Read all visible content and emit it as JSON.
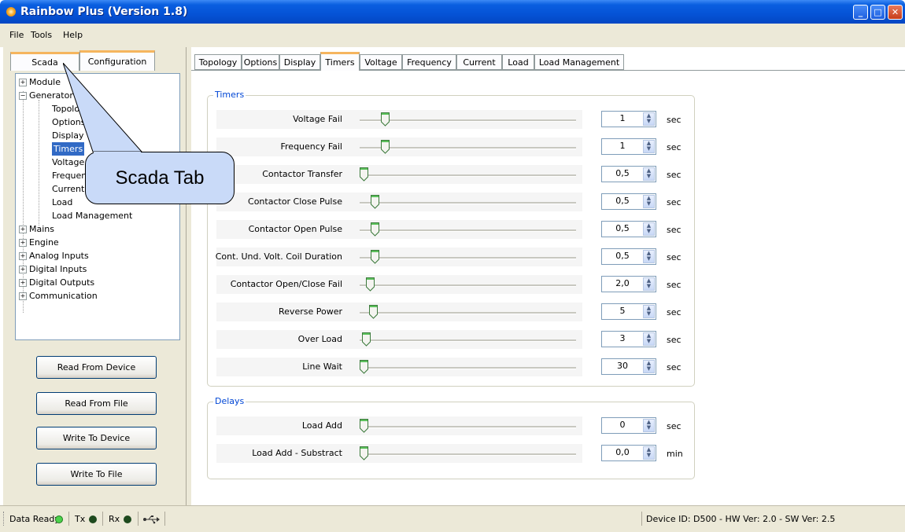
{
  "window": {
    "title": "Rainbow Plus (Version 1.8)"
  },
  "menu": [
    "File",
    "Tools",
    "Help"
  ],
  "left_tabs": [
    "Scada",
    "Configuration"
  ],
  "tree": {
    "module": "Module",
    "generator": "Generator",
    "generator_children": [
      "Topology",
      "Options",
      "Display",
      "Timers",
      "Voltage",
      "Frequency",
      "Current",
      "Load",
      "Load Management"
    ],
    "selected": "Timers",
    "others": [
      "Mains",
      "Engine",
      "Analog Inputs",
      "Digital Inputs",
      "Digital Outputs",
      "Communication"
    ]
  },
  "buttons": {
    "read_device": "Read From Device",
    "read_file": "Read From File",
    "write_device": "Write To Device",
    "write_file": "Write To File"
  },
  "right_tabs": [
    "Topology",
    "Options",
    "Display",
    "Timers",
    "Voltage",
    "Frequency",
    "Current",
    "Load",
    "Load Management"
  ],
  "active_tab": "Timers",
  "timers": {
    "title": "Timers",
    "rows": [
      {
        "label": "Voltage Fail",
        "value": "1",
        "unit": "sec"
      },
      {
        "label": "Frequency Fail",
        "value": "1",
        "unit": "sec"
      },
      {
        "label": "Contactor Transfer",
        "value": "0,5",
        "unit": "sec"
      },
      {
        "label": "Contactor Close Pulse",
        "value": "0,5",
        "unit": "sec"
      },
      {
        "label": "Contactor Open Pulse",
        "value": "0,5",
        "unit": "sec"
      },
      {
        "label": "Cont. Und. Volt. Coil Duration",
        "value": "0,5",
        "unit": "sec"
      },
      {
        "label": "Contactor Open/Close Fail",
        "value": "2,0",
        "unit": "sec"
      },
      {
        "label": "Reverse Power",
        "value": "5",
        "unit": "sec"
      },
      {
        "label": "Over Load",
        "value": "3",
        "unit": "sec"
      },
      {
        "label": "Line Wait",
        "value": "30",
        "unit": "sec"
      }
    ]
  },
  "delays": {
    "title": "Delays",
    "rows": [
      {
        "label": "Load Add",
        "value": "0",
        "unit": "sec"
      },
      {
        "label": "Load Add - Substract",
        "value": "0,0",
        "unit": "min"
      }
    ]
  },
  "callout": {
    "text": "Scada Tab"
  },
  "status": {
    "data_ready": "Data Ready",
    "tx": "Tx",
    "rx": "Rx",
    "device_info": "Device ID: D500 - HW Ver: 2.0 - SW Ver: 2.5",
    "led_green": "#4cd24c",
    "led_dark": "#1e4a1e"
  }
}
